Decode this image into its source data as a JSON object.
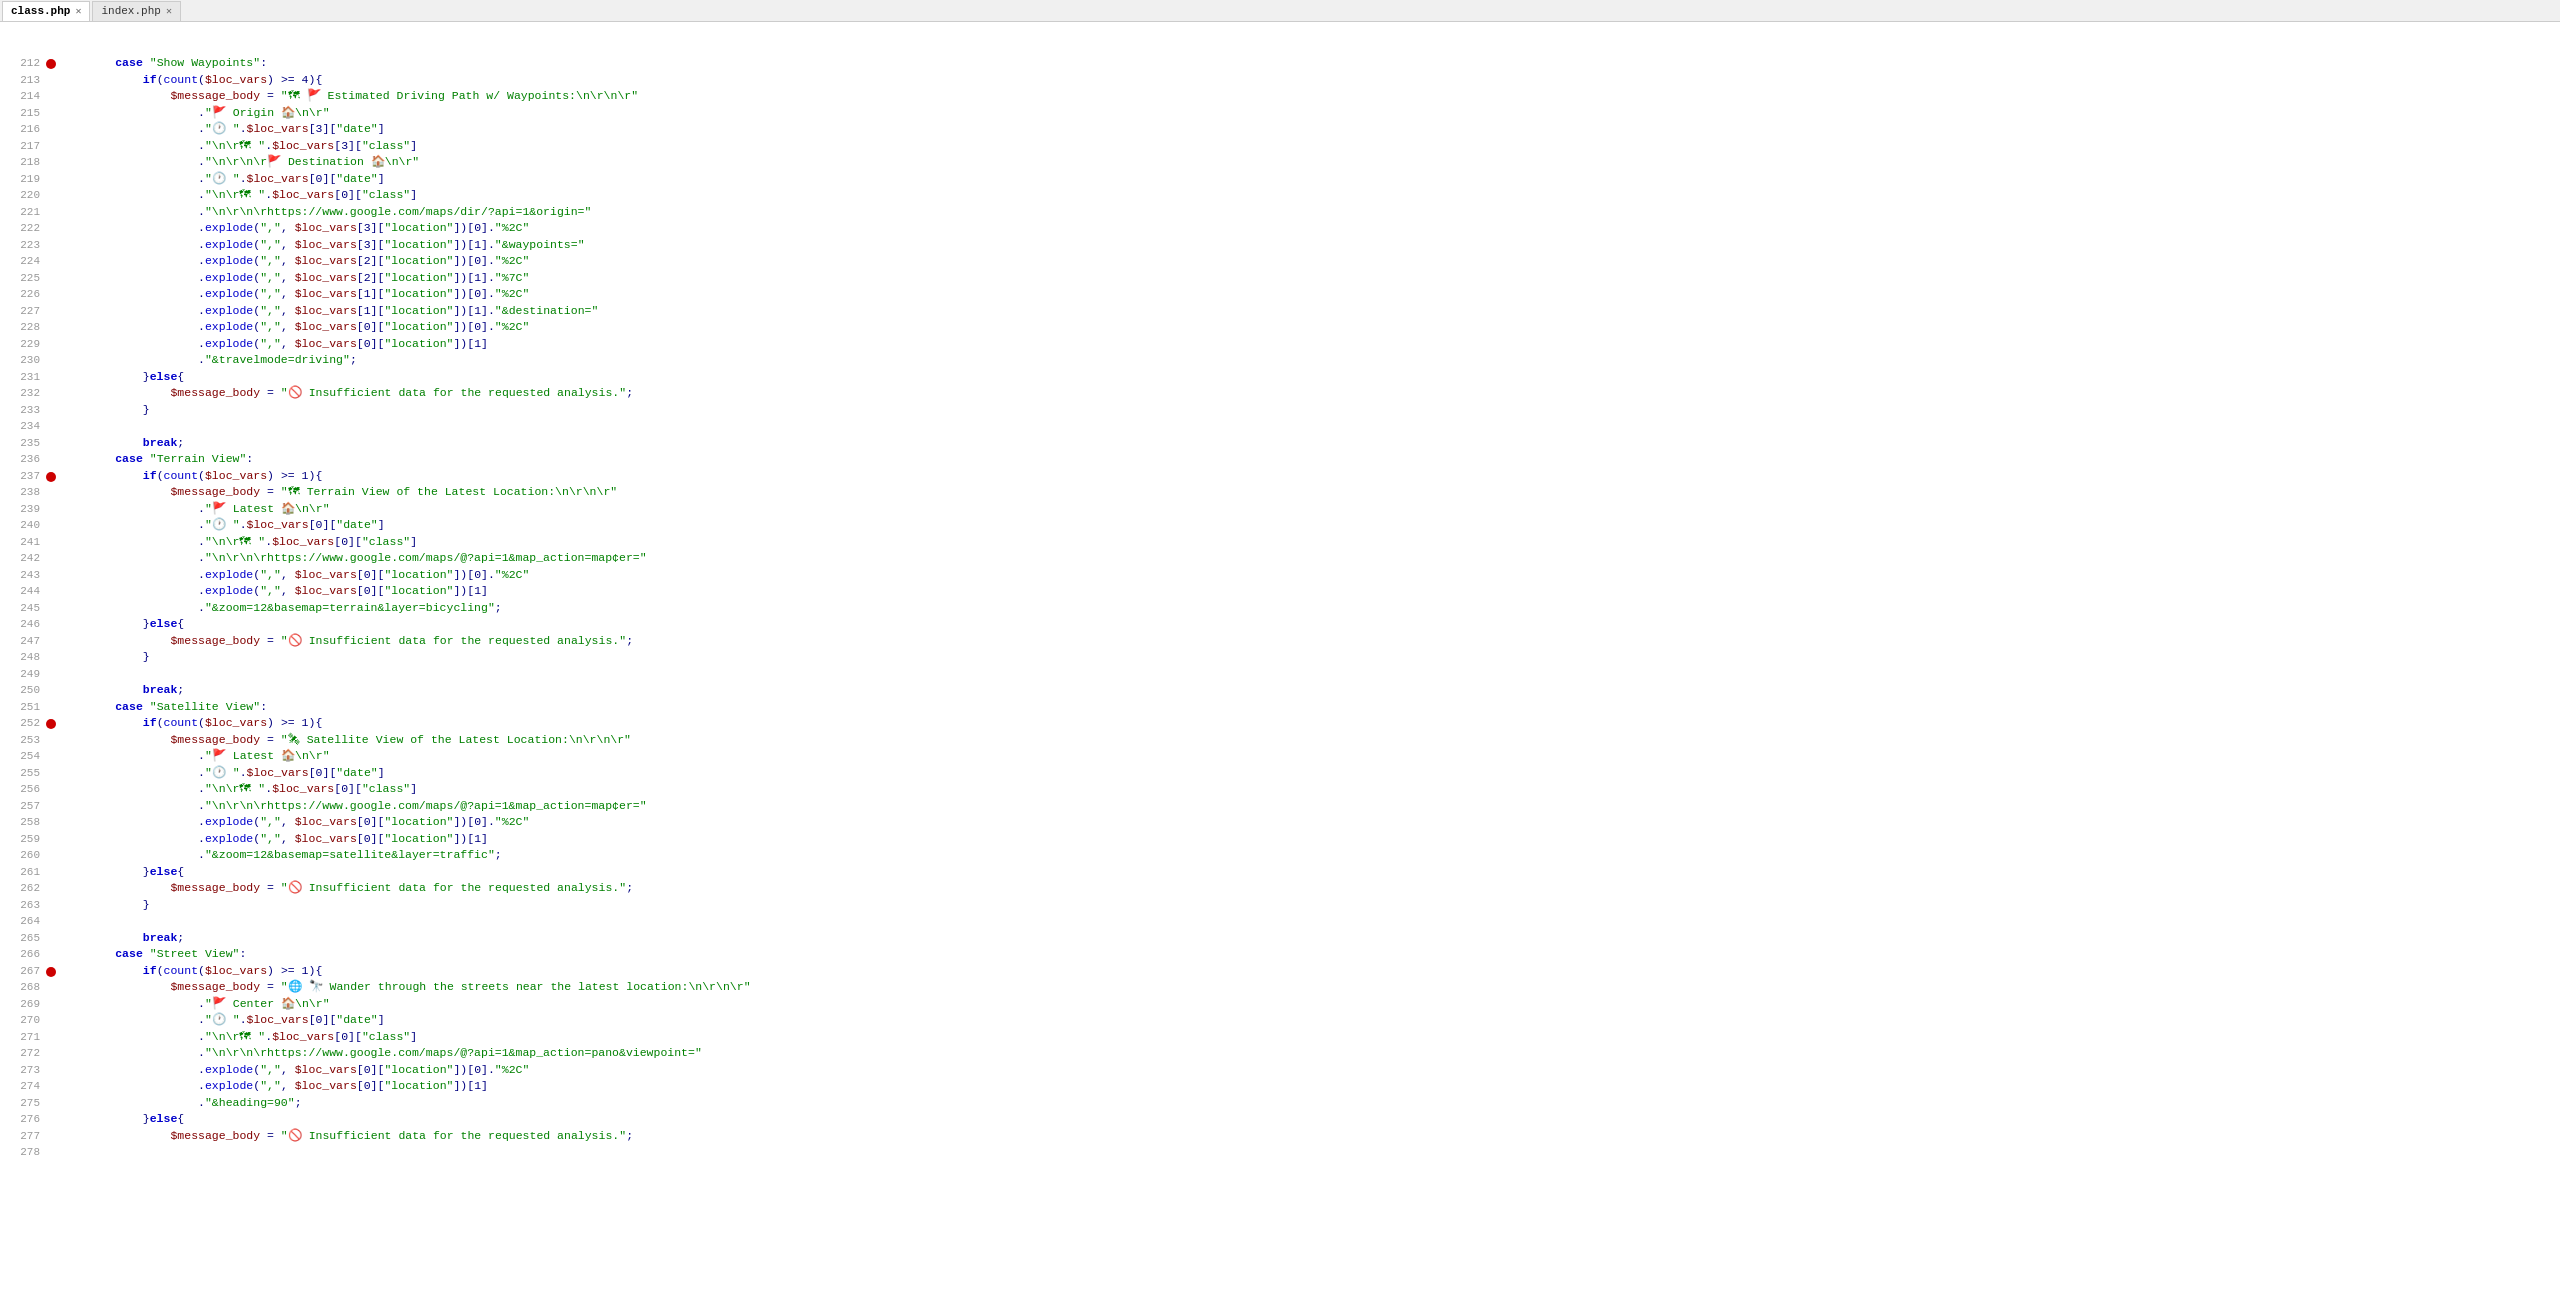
{
  "tabs": [
    {
      "label": "class.php",
      "active": true,
      "closable": true
    },
    {
      "label": "index.php",
      "active": false,
      "closable": true
    }
  ],
  "lines": [
    {
      "n": 212,
      "bp": true,
      "code": "        <case>case</case> <str>\"Show Waypoints\"</str>:"
    },
    {
      "n": 213,
      "bp": false,
      "code": "            <kw>if</kw>(<func>count</func>(<var>$loc_vars</var>) >= 4){"
    },
    {
      "n": 214,
      "bp": false,
      "code": "                <var>$message_body</var> = <str>\"🗺 🚩 Estimated Driving Path w/ Waypoints:\\n\\r\\n\\r\"</str>"
    },
    {
      "n": 215,
      "bp": false,
      "code": "                    .<str>\"🚩 Origin 🏠\\n\\r\"</str>"
    },
    {
      "n": 216,
      "bp": false,
      "code": "                    .<str>\"🕐 \"</str>.<var>$loc_vars</var>[3][<str>\"date\"</str>]"
    },
    {
      "n": 217,
      "bp": false,
      "code": "                    .<str>\"\\n\\r🗺 \"</str>.<var>$loc_vars</var>[3][<str>\"class\"</str>]"
    },
    {
      "n": 218,
      "bp": false,
      "code": "                    .<str>\"\\n\\r\\n\\r🚩 Destination 🏠\\n\\r\"</str>"
    },
    {
      "n": 219,
      "bp": false,
      "code": "                    .<str>\"🕐 \"</str>.<var>$loc_vars</var>[0][<str>\"date\"</str>]"
    },
    {
      "n": 220,
      "bp": false,
      "code": "                    .<str>\"\\n\\r🗺 \"</str>.<var>$loc_vars</var>[0][<str>\"class\"</str>]"
    },
    {
      "n": 221,
      "bp": false,
      "code": "                    .<str>\"\\n\\r\\n\\rhttps://www.google.com/maps/dir/?api=1&origin=\"</str>"
    },
    {
      "n": 222,
      "bp": false,
      "code": "                    .<func>explode</func>(<str>\",\"</str>, <var>$loc_vars</var>[3][<str>\"location\"</str>])[0].<str>\"%2C\"</str>"
    },
    {
      "n": 223,
      "bp": false,
      "code": "                    .<func>explode</func>(<str>\",\"</str>, <var>$loc_vars</var>[3][<str>\"location\"</str>])[1].<str>\"&waypoints=\"</str>"
    },
    {
      "n": 224,
      "bp": false,
      "code": "                    .<func>explode</func>(<str>\",\"</str>, <var>$loc_vars</var>[2][<str>\"location\"</str>])[0].<str>\"%2C\"</str>"
    },
    {
      "n": 225,
      "bp": false,
      "code": "                    .<func>explode</func>(<str>\",\"</str>, <var>$loc_vars</var>[2][<str>\"location\"</str>])[1].<str>\"%7C\"</str>"
    },
    {
      "n": 226,
      "bp": false,
      "code": "                    .<func>explode</func>(<str>\",\"</str>, <var>$loc_vars</var>[1][<str>\"location\"</str>])[0].<str>\"%2C\"</str>"
    },
    {
      "n": 227,
      "bp": false,
      "code": "                    .<func>explode</func>(<str>\",\"</str>, <var>$loc_vars</var>[1][<str>\"location\"</str>])[1].<str>\"&destination=\"</str>"
    },
    {
      "n": 228,
      "bp": false,
      "code": "                    .<func>explode</func>(<str>\",\"</str>, <var>$loc_vars</var>[0][<str>\"location\"</str>])[0].<str>\"%2C\"</str>"
    },
    {
      "n": 229,
      "bp": false,
      "code": "                    .<func>explode</func>(<str>\",\"</str>, <var>$loc_vars</var>[0][<str>\"location\"</str>])[1]"
    },
    {
      "n": 230,
      "bp": false,
      "code": "                    .<str>\"&travelmode=driving\"</str>;"
    },
    {
      "n": 231,
      "bp": false,
      "code": "            }<kw>else</kw>{"
    },
    {
      "n": 232,
      "bp": false,
      "code": "                <var>$message_body</var> = <str>\"🚫 Insufficient data for the requested analysis.\"</str>;"
    },
    {
      "n": 233,
      "bp": false,
      "code": "            }"
    },
    {
      "n": 234,
      "bp": false,
      "code": ""
    },
    {
      "n": 235,
      "bp": false,
      "code": "            <kw>break</kw>;"
    },
    {
      "n": 236,
      "bp": false,
      "code": "        <case>case</case> <str>\"Terrain View\"</str>:"
    },
    {
      "n": 237,
      "bp": true,
      "code": "            <kw>if</kw>(<func>count</func>(<var>$loc_vars</var>) >= 1){"
    },
    {
      "n": 238,
      "bp": false,
      "code": "                <var>$message_body</var> = <str>\"🗺 Terrain View of the Latest Location:\\n\\r\\n\\r\"</str>"
    },
    {
      "n": 239,
      "bp": false,
      "code": "                    .<str>\"🚩 Latest 🏠\\n\\r\"</str>"
    },
    {
      "n": 240,
      "bp": false,
      "code": "                    .<str>\"🕐 \"</str>.<var>$loc_vars</var>[0][<str>\"date\"</str>]"
    },
    {
      "n": 241,
      "bp": false,
      "code": "                    .<str>\"\\n\\r🗺 \"</str>.<var>$loc_vars</var>[0][<str>\"class\"</str>]"
    },
    {
      "n": 242,
      "bp": false,
      "code": "                    .<str>\"\\n\\r\\n\\rhttps://www.google.com/maps/@?api=1&map_action=map&center=\"</str>"
    },
    {
      "n": 243,
      "bp": false,
      "code": "                    .<func>explode</func>(<str>\",\"</str>, <var>$loc_vars</var>[0][<str>\"location\"</str>])[0].<str>\"%2C\"</str>"
    },
    {
      "n": 244,
      "bp": false,
      "code": "                    .<func>explode</func>(<str>\",\"</str>, <var>$loc_vars</var>[0][<str>\"location\"</str>])[1]"
    },
    {
      "n": 245,
      "bp": false,
      "code": "                    .<str>\"&zoom=12&basemap=terrain&layer=bicycling\"</str>;"
    },
    {
      "n": 246,
      "bp": false,
      "code": "            }<kw>else</kw>{"
    },
    {
      "n": 247,
      "bp": false,
      "code": "                <var>$message_body</var> = <str>\"🚫 Insufficient data for the requested analysis.\"</str>;"
    },
    {
      "n": 248,
      "bp": false,
      "code": "            }"
    },
    {
      "n": 249,
      "bp": false,
      "code": ""
    },
    {
      "n": 250,
      "bp": false,
      "code": "            <kw>break</kw>;"
    },
    {
      "n": 251,
      "bp": false,
      "code": "        <case>case</case> <str>\"Satellite View\"</str>:"
    },
    {
      "n": 252,
      "bp": true,
      "code": "            <kw>if</kw>(<func>count</func>(<var>$loc_vars</var>) >= 1){"
    },
    {
      "n": 253,
      "bp": false,
      "code": "                <var>$message_body</var> = <str>\"🛰 Satellite View of the Latest Location:\\n\\r\\n\\r\"</str>"
    },
    {
      "n": 254,
      "bp": false,
      "code": "                    .<str>\"🚩 Latest 🏠\\n\\r\"</str>"
    },
    {
      "n": 255,
      "bp": false,
      "code": "                    .<str>\"🕐 \"</str>.<var>$loc_vars</var>[0][<str>\"date\"</str>]"
    },
    {
      "n": 256,
      "bp": false,
      "code": "                    .<str>\"\\n\\r🗺 \"</str>.<var>$loc_vars</var>[0][<str>\"class\"</str>]"
    },
    {
      "n": 257,
      "bp": false,
      "code": "                    .<str>\"\\n\\r\\n\\rhttps://www.google.com/maps/@?api=1&map_action=map&center=\"</str>"
    },
    {
      "n": 258,
      "bp": false,
      "code": "                    .<func>explode</func>(<str>\",\"</str>, <var>$loc_vars</var>[0][<str>\"location\"</str>])[0].<str>\"%2C\"</str>"
    },
    {
      "n": 259,
      "bp": false,
      "code": "                    .<func>explode</func>(<str>\",\"</str>, <var>$loc_vars</var>[0][<str>\"location\"</str>])[1]"
    },
    {
      "n": 260,
      "bp": false,
      "code": "                    .<str>\"&zoom=12&basemap=satellite&layer=traffic\"</str>;"
    },
    {
      "n": 261,
      "bp": false,
      "code": "            }<kw>else</kw>{"
    },
    {
      "n": 262,
      "bp": false,
      "code": "                <var>$message_body</var> = <str>\"🚫 Insufficient data for the requested analysis.\"</str>;"
    },
    {
      "n": 263,
      "bp": false,
      "code": "            }"
    },
    {
      "n": 264,
      "bp": false,
      "code": ""
    },
    {
      "n": 265,
      "bp": false,
      "code": "            <kw>break</kw>;"
    },
    {
      "n": 266,
      "bp": false,
      "code": "        <case>case</case> <str>\"Street View\"</str>:"
    },
    {
      "n": 267,
      "bp": true,
      "code": "            <kw>if</kw>(<func>count</func>(<var>$loc_vars</var>) >= 1){"
    },
    {
      "n": 268,
      "bp": false,
      "code": "                <var>$message_body</var> = <str>\"🌐 🔭 Wander through the streets near the latest location:\\n\\r\\n\\r\"</str>"
    },
    {
      "n": 269,
      "bp": false,
      "code": "                    .<str>\"🚩 Center 🏠\\n\\r\"</str>"
    },
    {
      "n": 270,
      "bp": false,
      "code": "                    .<str>\"🕐 \"</str>.<var>$loc_vars</var>[0][<str>\"date\"</str>]"
    },
    {
      "n": 271,
      "bp": false,
      "code": "                    .<str>\"\\n\\r🗺 \"</str>.<var>$loc_vars</var>[0][<str>\"class\"</str>]"
    },
    {
      "n": 272,
      "bp": false,
      "code": "                    .<str>\"\\n\\r\\n\\rhttps://www.google.com/maps/@?api=1&map_action=pano&viewpoint=\"</str>"
    },
    {
      "n": 273,
      "bp": false,
      "code": "                    .<func>explode</func>(<str>\",\"</str>, <var>$loc_vars</var>[0][<str>\"location\"</str>])[0].<str>\"%2C\"</str>"
    },
    {
      "n": 274,
      "bp": false,
      "code": "                    .<func>explode</func>(<str>\",\"</str>, <var>$loc_vars</var>[0][<str>\"location\"</str>])[1]"
    },
    {
      "n": 275,
      "bp": false,
      "code": "                    .<str>\"&heading=90\"</str>;"
    },
    {
      "n": 276,
      "bp": false,
      "code": "            }<kw>else</kw>{"
    },
    {
      "n": 277,
      "bp": false,
      "code": "                <var>$message_body</var> = <str>\"🚫 Insufficient data for the requested analysis.\"</str>;"
    },
    {
      "n": 278,
      "bp": false,
      "code": ""
    }
  ]
}
